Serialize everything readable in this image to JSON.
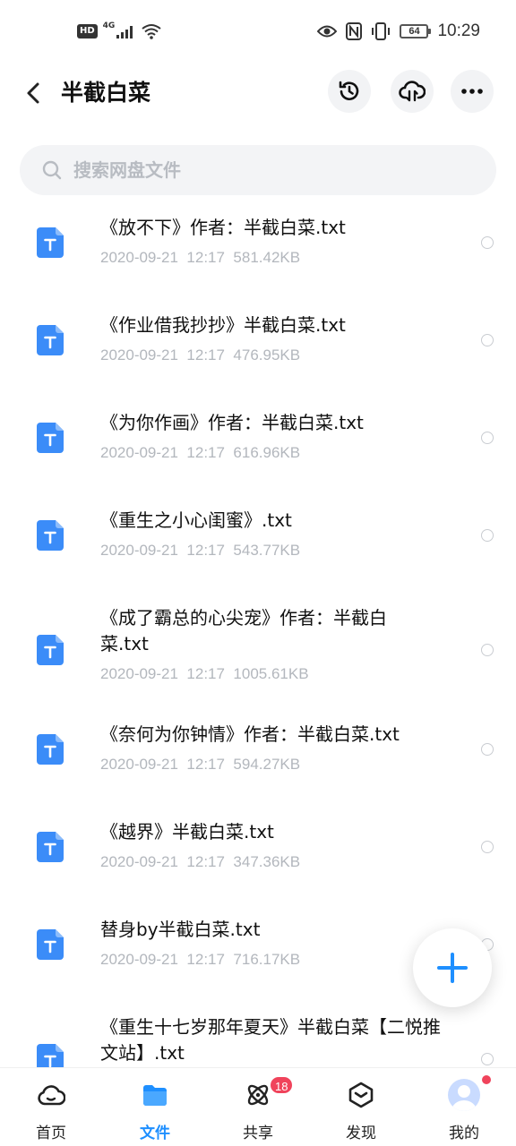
{
  "status_bar": {
    "left_badge": "HD",
    "network": "4G",
    "battery": "64",
    "time": "10:29"
  },
  "header": {
    "title": "半截白菜"
  },
  "search": {
    "placeholder": "搜索网盘文件"
  },
  "files": [
    {
      "name": "《放不下》作者：半截白菜.txt",
      "date": "2020-09-21",
      "time": "12:17",
      "size": "581.42KB"
    },
    {
      "name": "《作业借我抄抄》半截白菜.txt",
      "date": "2020-09-21",
      "time": "12:17",
      "size": "476.95KB"
    },
    {
      "name": "《为你作画》作者：半截白菜.txt",
      "date": "2020-09-21",
      "time": "12:17",
      "size": "616.96KB"
    },
    {
      "name": "《重生之小心闺蜜》.txt",
      "date": "2020-09-21",
      "time": "12:17",
      "size": "543.77KB"
    },
    {
      "name": "《成了霸总的心尖宠》作者：半截白菜.txt",
      "date": "2020-09-21",
      "time": "12:17",
      "size": "1005.61KB"
    },
    {
      "name": "《奈何为你钟情》作者：半截白菜.txt",
      "date": "2020-09-21",
      "time": "12:17",
      "size": "594.27KB"
    },
    {
      "name": "《越界》半截白菜.txt",
      "date": "2020-09-21",
      "time": "12:17",
      "size": "347.36KB"
    },
    {
      "name": "替身by半截白菜.txt",
      "date": "2020-09-21",
      "time": "12:17",
      "size": "716.17KB"
    },
    {
      "name": "《重生十七岁那年夏天》半截白菜【二悦推文站】.txt",
      "date": "",
      "time": "",
      "size": ""
    }
  ],
  "tabs": [
    {
      "label": "首页",
      "icon": "cloud-home-icon"
    },
    {
      "label": "文件",
      "icon": "folder-icon"
    },
    {
      "label": "共享",
      "icon": "atom-share-icon",
      "badge": "18"
    },
    {
      "label": "发现",
      "icon": "discover-icon"
    },
    {
      "label": "我的",
      "icon": "avatar"
    }
  ],
  "colors": {
    "accent": "#1e8fff",
    "file_icon": "#3b8cf8",
    "badge": "#f0435b"
  }
}
